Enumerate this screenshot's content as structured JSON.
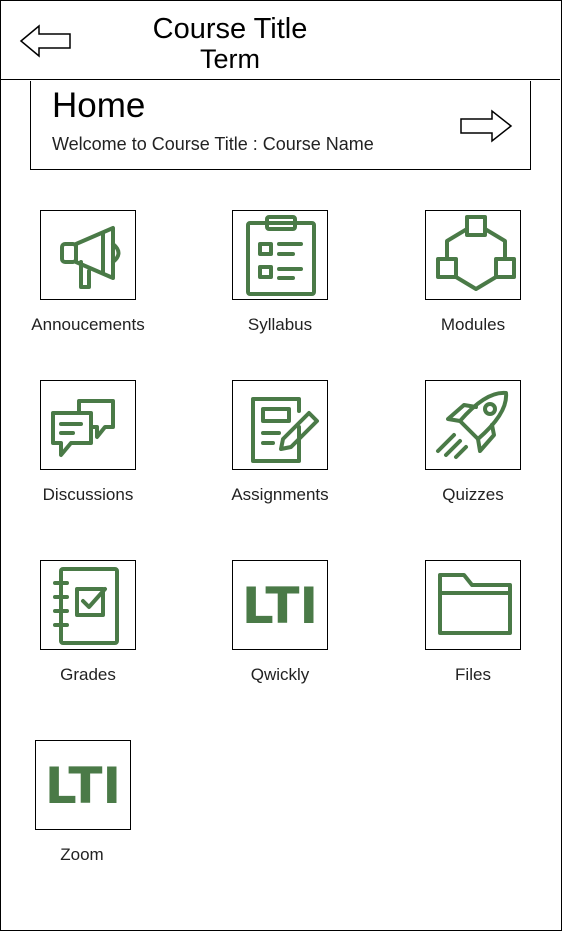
{
  "header": {
    "title": "Course Title",
    "term": "Term"
  },
  "home": {
    "title": "Home",
    "welcome": "Welcome to Course Title : Course Name"
  },
  "tiles": [
    {
      "label": "Annoucements",
      "icon": "megaphone-icon"
    },
    {
      "label": "Syllabus",
      "icon": "clipboard-icon"
    },
    {
      "label": "Modules",
      "icon": "modules-icon"
    },
    {
      "label": "Discussions",
      "icon": "discussion-bubbles-icon"
    },
    {
      "label": "Assignments",
      "icon": "assignment-icon"
    },
    {
      "label": "Quizzes",
      "icon": "rocket-icon"
    },
    {
      "label": "Grades",
      "icon": "gradebook-icon"
    },
    {
      "label": "Qwickly",
      "icon": "lti-icon",
      "icon_text": "LTI"
    },
    {
      "label": "Files",
      "icon": "folder-icon"
    },
    {
      "label": "Zoom",
      "icon": "lti-icon",
      "icon_text": "LTI"
    }
  ],
  "colors": {
    "icon": "#4a7a47",
    "border": "#000000"
  }
}
